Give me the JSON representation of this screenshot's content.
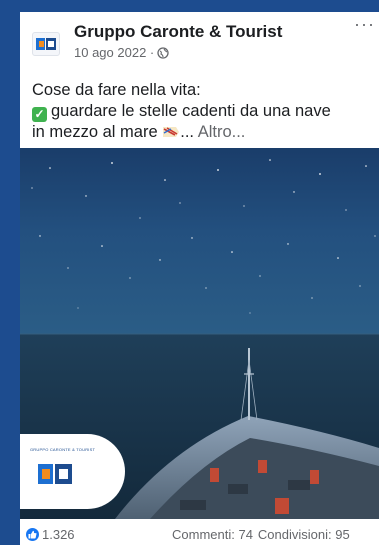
{
  "post": {
    "author": "Gruppo Caronte & Tourist",
    "date": "10 ago 2022 ·",
    "more": "···",
    "line1": "Cose da fare nella vita:",
    "line2": "guardare le stelle cadenti da una nave",
    "line3": "in mezzo al mare",
    "ellipsis": "...",
    "see_more": "Altro..."
  },
  "logo": {
    "small_text": "GRUPPO CARONTE & TOURIST",
    "mark_text": "C&T"
  },
  "footer": {
    "likes": "1.326",
    "comments": "Commenti: 74",
    "shares": "Condivisioni: 95"
  },
  "icons": {
    "privacy": "globe-icon",
    "like": "thumbs-up-icon",
    "check": "check-mark-icon"
  },
  "colors": {
    "background": "#1d4c8f",
    "like": "#1877f2",
    "check": "#3fb24f",
    "sea": "#1b3a4e"
  }
}
